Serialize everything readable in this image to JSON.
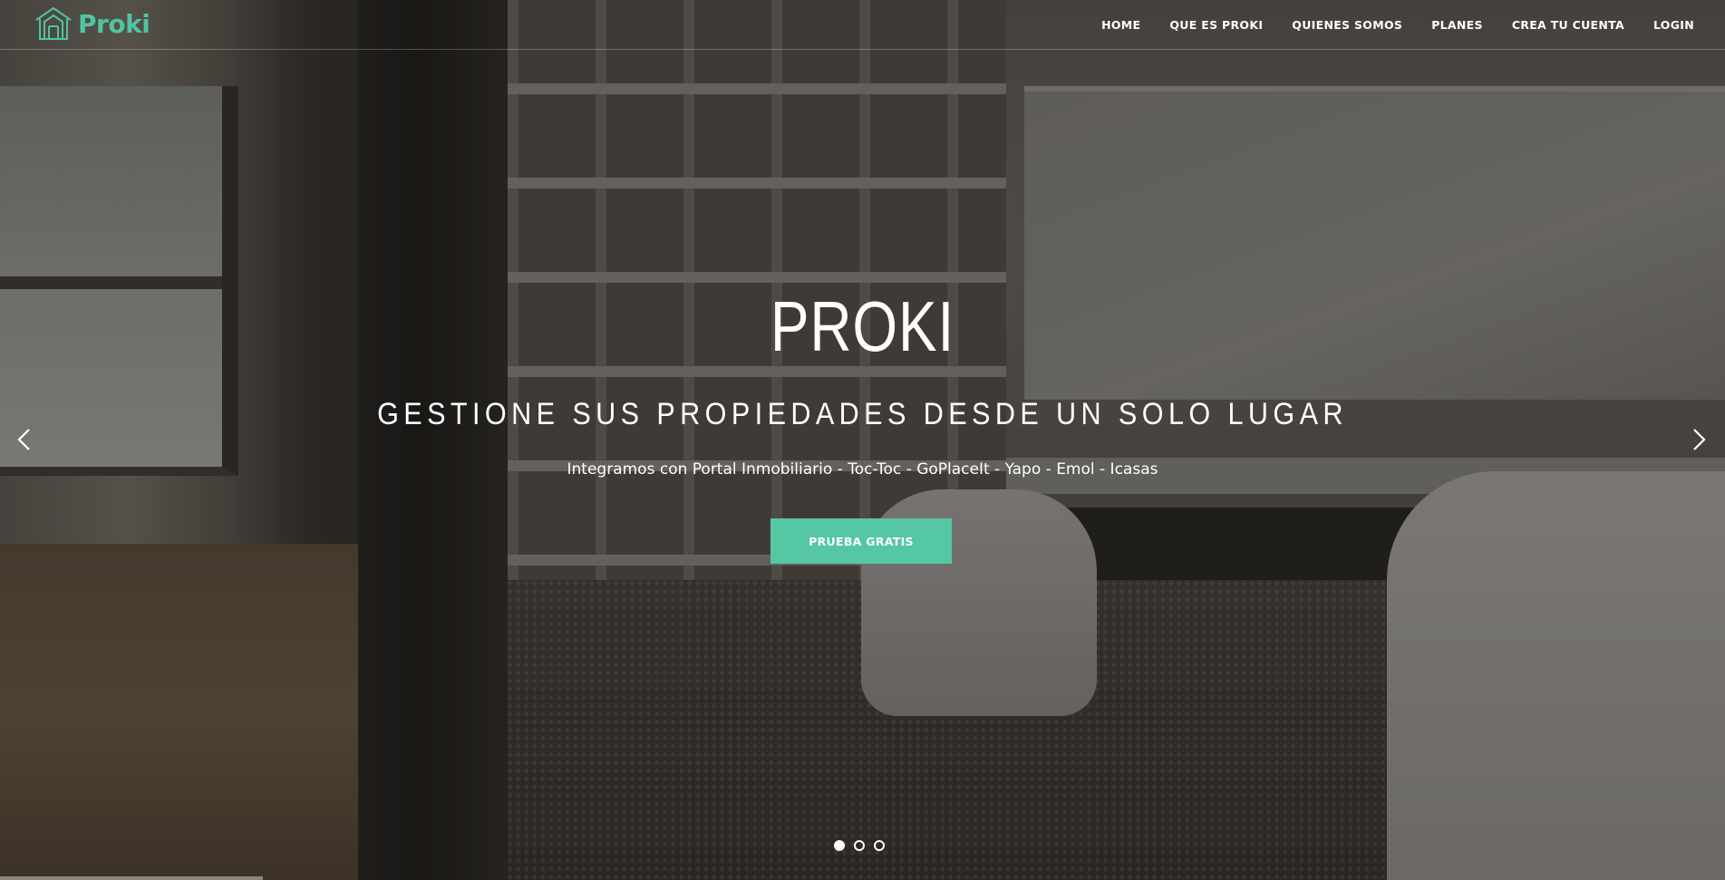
{
  "brand": {
    "name": "Proki",
    "color": "#4fc4a0"
  },
  "nav": {
    "items": [
      {
        "label": "HOME"
      },
      {
        "label": "QUE ES PROKI"
      },
      {
        "label": "QUIENES SOMOS"
      },
      {
        "label": "PLANES"
      },
      {
        "label": "CREA TU CUENTA"
      },
      {
        "label": "LOGIN"
      }
    ]
  },
  "hero": {
    "title": "PROKI",
    "subtitle": "GESTIONE SUS PROPIEDADES DESDE UN SOLO LUGAR",
    "text": "Integramos con Portal Inmobiliario - Toc-Toc - GoPlaceIt - Yapo - Emol - Icasas",
    "cta_label": "PRUEBA GRATIS",
    "cta_color": "#55c7a4"
  },
  "carousel": {
    "prev_icon": "chevron-left-icon",
    "next_icon": "chevron-right-icon",
    "slide_count": 3,
    "active_slide": 1
  }
}
